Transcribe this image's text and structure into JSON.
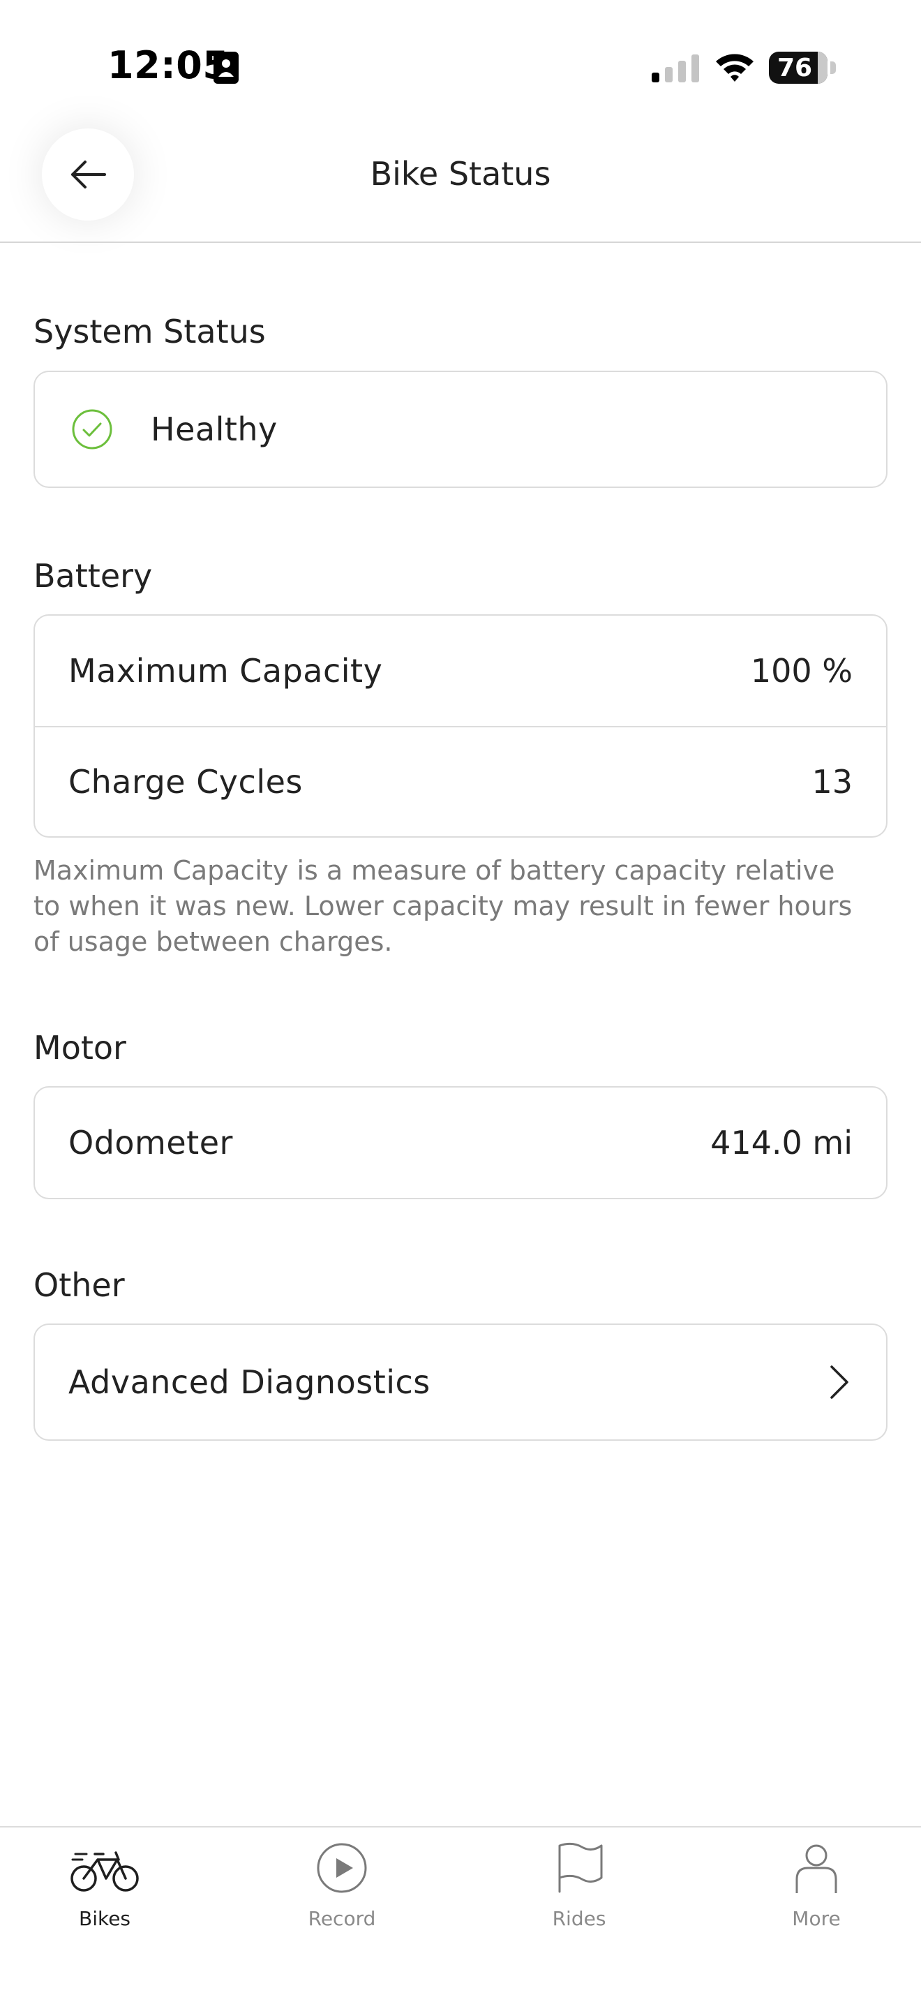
{
  "status_bar": {
    "time": "12:05",
    "battery_level": "76"
  },
  "header": {
    "title": "Bike Status"
  },
  "system_status": {
    "title": "System Status",
    "status_text": "Healthy",
    "status_color": "#6cbf3c"
  },
  "battery": {
    "title": "Battery",
    "rows": [
      {
        "label": "Maximum Capacity",
        "value": "100 %"
      },
      {
        "label": "Charge Cycles",
        "value": "13"
      }
    ],
    "footnote": "Maximum Capacity is a measure of battery capacity relative to when it was new. Lower capacity may result in fewer hours of usage between charges."
  },
  "motor": {
    "title": "Motor",
    "rows": [
      {
        "label": "Odometer",
        "value": "414.0 mi"
      }
    ]
  },
  "other": {
    "title": "Other",
    "rows": [
      {
        "label": "Advanced Diagnostics",
        "icon": "chevron-right-icon"
      }
    ]
  },
  "tab_bar": {
    "tabs": [
      {
        "label": "Bikes",
        "icon": "bike-icon",
        "active": true
      },
      {
        "label": "Record",
        "icon": "play-icon",
        "active": false
      },
      {
        "label": "Rides",
        "icon": "flag-icon",
        "active": false
      },
      {
        "label": "More",
        "icon": "person-icon",
        "active": false
      }
    ]
  }
}
